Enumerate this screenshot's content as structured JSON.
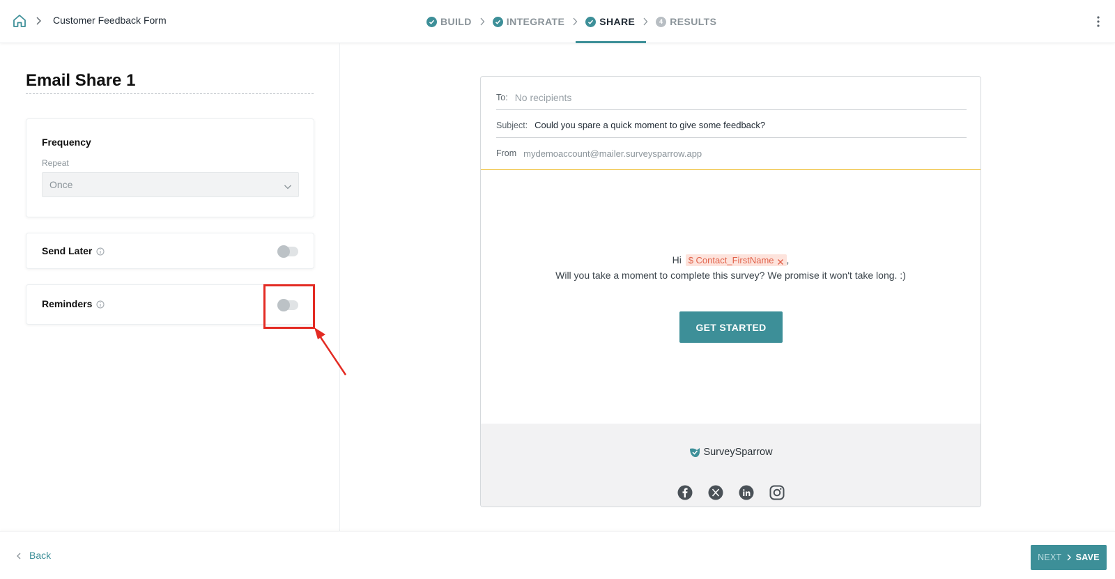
{
  "header": {
    "breadcrumb_title": "Customer Feedback Form",
    "steps": [
      {
        "label": "BUILD",
        "state": "done"
      },
      {
        "label": "INTEGRATE",
        "state": "done"
      },
      {
        "label": "SHARE",
        "state": "active"
      },
      {
        "label": "RESULTS",
        "state": "pending",
        "number": "4"
      }
    ]
  },
  "left_panel": {
    "title": "Email Share 1",
    "frequency": {
      "heading": "Frequency",
      "repeat_label": "Repeat",
      "repeat_value": "Once"
    },
    "send_later": {
      "label": "Send Later",
      "enabled": false
    },
    "reminders": {
      "label": "Reminders",
      "enabled": false
    }
  },
  "email_preview": {
    "to_key": "To:",
    "to_value": "No recipients",
    "subject_key": "Subject:",
    "subject_value": "Could you spare a quick moment to give some feedback?",
    "from_key": "From",
    "from_value": "mydemoaccount@mailer.surveysparrow.app",
    "greeting": "Hi",
    "merge_tag": "$ Contact_FirstName",
    "greeting_punct": ",",
    "body_text": "Will you take a moment to complete this survey? We promise it won't take long. :)",
    "cta_label": "GET STARTED",
    "brand_name": "SurveySparrow",
    "socials": [
      "facebook-icon",
      "x-icon",
      "linkedin-icon",
      "instagram-icon"
    ]
  },
  "footer": {
    "back_label": "Back",
    "next_label": "NEXT",
    "save_label": "SAVE"
  },
  "colors": {
    "accent": "#3d8f98",
    "annotation": "#e32b23",
    "divider_gold": "#f0c64a",
    "tag_bg": "#fde3dc",
    "tag_text": "#e1624a"
  }
}
